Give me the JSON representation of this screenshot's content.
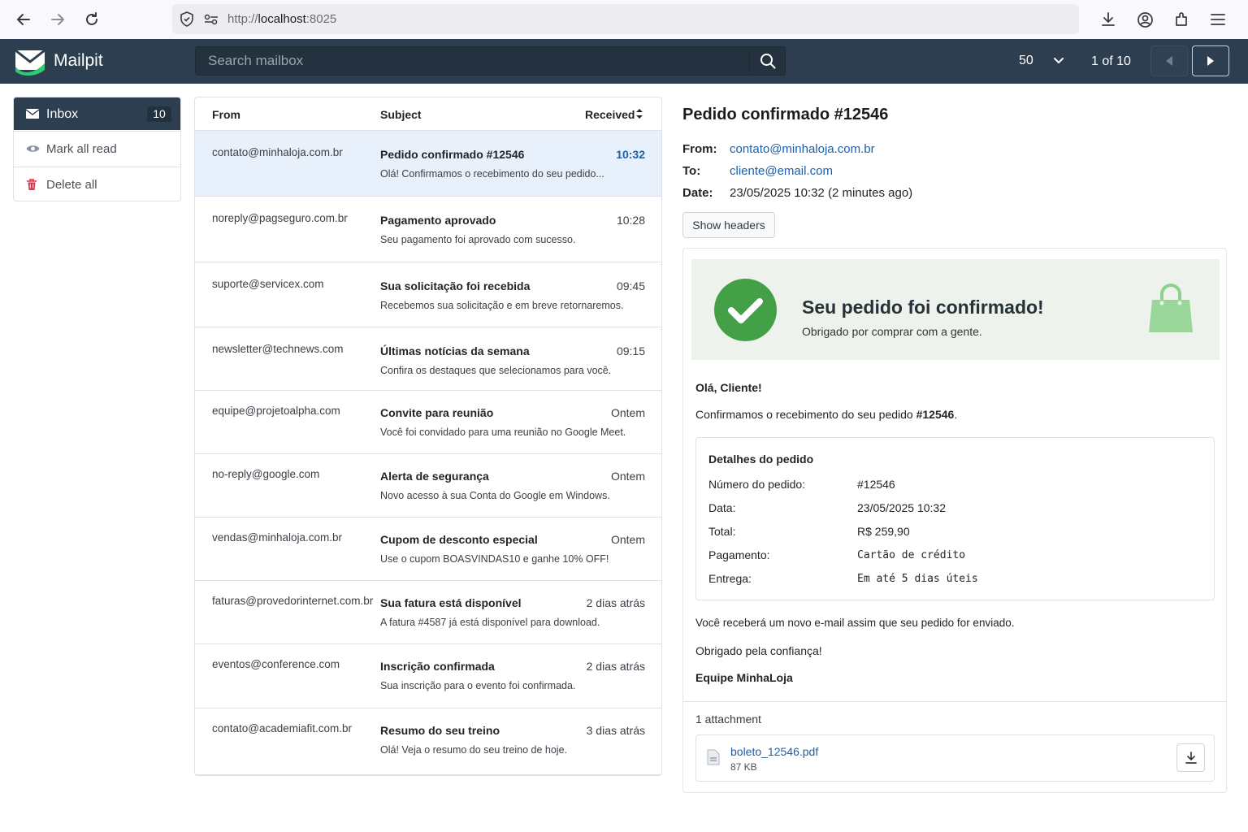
{
  "browser": {
    "url_scheme": "http://",
    "url_host": "localhost",
    "url_port": ":8025"
  },
  "header": {
    "app_name": "Mailpit",
    "search_placeholder": "Search mailbox",
    "per_page": "50",
    "page_info": "1 of 10"
  },
  "sidebar": {
    "inbox_label": "Inbox",
    "inbox_count": "10",
    "mark_all_read": "Mark all read",
    "delete_all": "Delete all"
  },
  "list": {
    "col_from": "From",
    "col_subject": "Subject",
    "col_received": "Received",
    "messages": [
      {
        "from": "contato@minhaloja.com.br",
        "subject": "Pedido confirmado #12546",
        "snippet": "Olá! Confirmamos o recebimento do seu pedido...",
        "time": "10:32",
        "selected": true
      },
      {
        "from": "noreply@pagseguro.com.br",
        "subject": "Pagamento aprovado",
        "snippet": "Seu pagamento foi aprovado com sucesso.",
        "time": "10:28"
      },
      {
        "from": "suporte@servicex.com",
        "subject": "Sua solicitação foi recebida",
        "snippet": "Recebemos sua solicitação e em breve retornaremos.",
        "time": "09:45"
      },
      {
        "from": "newsletter@technews.com",
        "subject": "Últimas notícias da semana",
        "snippet": "Confira os destaques que selecionamos para você.",
        "time": "09:15"
      },
      {
        "from": "equipe@projetoalpha.com",
        "subject": "Convite para reunião",
        "snippet": "Você foi convidado para uma reunião no Google Meet.",
        "time": "Ontem"
      },
      {
        "from": "no-reply@google.com",
        "subject": "Alerta de segurança",
        "snippet": "Novo acesso à sua Conta do Google em Windows.",
        "time": "Ontem"
      },
      {
        "from": "vendas@minhaloja.com.br",
        "subject": "Cupom de desconto especial",
        "snippet": "Use o cupom BOASVINDAS10 e ganhe 10% OFF!",
        "time": "Ontem"
      },
      {
        "from": "faturas@provedorinternet.com.br",
        "subject": "Sua fatura está disponível",
        "snippet": "A fatura #4587 já está disponível para download.",
        "time": "2 dias atrás"
      },
      {
        "from": "eventos@conference.com",
        "subject": "Inscrição confirmada",
        "snippet": "Sua inscrição para o evento foi confirmada.",
        "time": "2 dias atrás"
      },
      {
        "from": "contato@academiafit.com.br",
        "subject": "Resumo do seu treino",
        "snippet": "Olá! Veja o resumo do seu treino de hoje.",
        "time": "3 dias atrás"
      }
    ]
  },
  "message": {
    "title": "Pedido confirmado #12546",
    "from_label": "From:",
    "from": "contato@minhaloja.com.br",
    "to_label": "To:",
    "to": "cliente@email.com",
    "date_label": "Date:",
    "date": "23/05/2025 10:32 (2 minutes ago)",
    "show_headers": "Show headers",
    "body": {
      "banner_title": "Seu pedido foi confirmado!",
      "banner_subtitle": "Obrigado por comprar com a gente.",
      "greeting": "Olá, Cliente!",
      "confirm_text": "Confirmamos o recebimento do seu pedido ",
      "confirm_order": "#12546",
      "confirm_end": ".",
      "details_title": "Detalhes do pedido",
      "details": [
        {
          "label": "Número do pedido:",
          "value": "#12546",
          "mono": false
        },
        {
          "label": "Data:",
          "value": "23/05/2025 10:32",
          "mono": false
        },
        {
          "label": "Total:",
          "value": "R$ 259,90",
          "mono": false
        },
        {
          "label": "Pagamento:",
          "value": "Cartão de crédito",
          "mono": true
        },
        {
          "label": "Entrega:",
          "value": "Em até 5 dias úteis",
          "mono": true
        }
      ],
      "notice": "Você receberá um novo e-mail assim que seu pedido for enviado.",
      "thanks": "Obrigado pela confiança!",
      "signature": "Equipe MinhaLoja"
    },
    "attachments_count": "1 attachment",
    "attachment": {
      "name": "boleto_12546.pdf",
      "size": "87 KB"
    }
  },
  "colors": {
    "header_bg": "#2c3e50",
    "accent_link": "#1d5fa8",
    "success_green": "#43a047",
    "banner_bg": "#edf3ec",
    "selected_row_bg": "#e8f0fb"
  }
}
